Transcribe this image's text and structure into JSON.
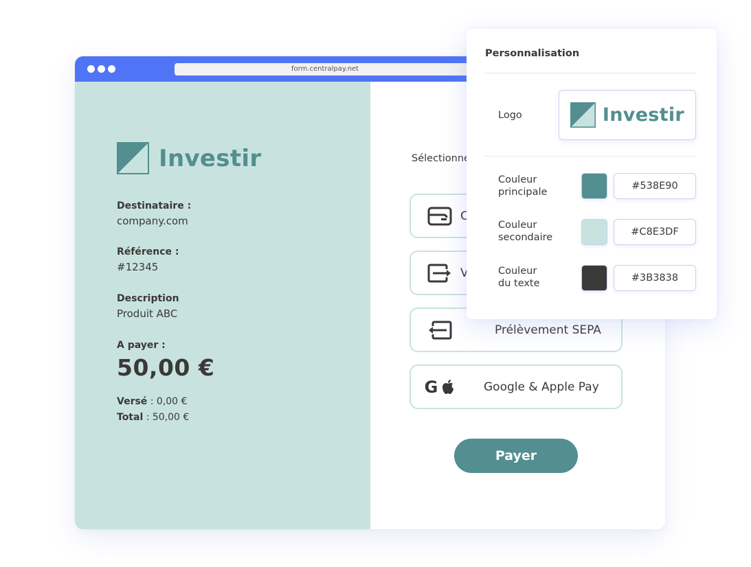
{
  "browser": {
    "url": "form.centralpay.net"
  },
  "merchant": {
    "brand_name": "Investir",
    "fields": [
      {
        "label": "Destinataire :",
        "value": "company.com"
      },
      {
        "label": "Référence :",
        "value": "#12345"
      },
      {
        "label": "Description",
        "value": "Produit ABC"
      }
    ],
    "amount_label": "A payer :",
    "amount": "50,00 €",
    "paid_label": "Versé",
    "paid_value": " : 0,00 €",
    "total_label": "Total",
    "total_value": " : 50,00 €"
  },
  "payment": {
    "select_label": "Sélectionnez un moyen de paiement",
    "options": [
      {
        "icon": "card-icon",
        "label": "Carte bancaire"
      },
      {
        "icon": "transfer-out-icon",
        "label": "Virement"
      },
      {
        "icon": "transfer-in-icon",
        "label": "Prélèvement SEPA"
      },
      {
        "icon": "google-apple-icon",
        "label": "Google & Apple Pay"
      }
    ],
    "pay_button": "Payer"
  },
  "personalisation": {
    "title": "Personnalisation",
    "logo_label": "Logo",
    "logo_brand": "Investir",
    "colors": [
      {
        "label_line1": "Couleur",
        "label_line2": "principale",
        "hex": "#538E90"
      },
      {
        "label_line1": "Couleur",
        "label_line2": "secondaire",
        "hex": "#C8E3DF"
      },
      {
        "label_line1": "Couleur",
        "label_line2": "du texte",
        "hex": "#3B3838"
      }
    ]
  },
  "theme": {
    "primary": "#538E90",
    "secondary": "#C8E3DF",
    "text": "#3B3838",
    "browser_bar": "#4F74F5"
  }
}
